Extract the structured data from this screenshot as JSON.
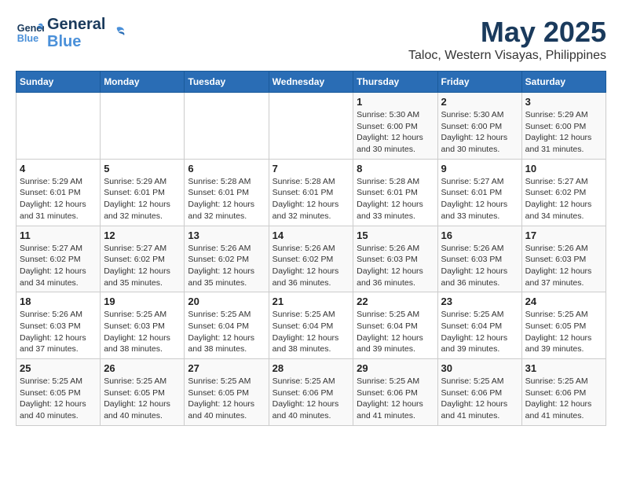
{
  "logo": {
    "line1": "General",
    "line2": "Blue"
  },
  "title": "May 2025",
  "subtitle": "Taloc, Western Visayas, Philippines",
  "weekdays": [
    "Sunday",
    "Monday",
    "Tuesday",
    "Wednesday",
    "Thursday",
    "Friday",
    "Saturday"
  ],
  "weeks": [
    [
      {
        "day": "",
        "info": ""
      },
      {
        "day": "",
        "info": ""
      },
      {
        "day": "",
        "info": ""
      },
      {
        "day": "",
        "info": ""
      },
      {
        "day": "1",
        "info": "Sunrise: 5:30 AM\nSunset: 6:00 PM\nDaylight: 12 hours\nand 30 minutes."
      },
      {
        "day": "2",
        "info": "Sunrise: 5:30 AM\nSunset: 6:00 PM\nDaylight: 12 hours\nand 30 minutes."
      },
      {
        "day": "3",
        "info": "Sunrise: 5:29 AM\nSunset: 6:00 PM\nDaylight: 12 hours\nand 31 minutes."
      }
    ],
    [
      {
        "day": "4",
        "info": "Sunrise: 5:29 AM\nSunset: 6:01 PM\nDaylight: 12 hours\nand 31 minutes."
      },
      {
        "day": "5",
        "info": "Sunrise: 5:29 AM\nSunset: 6:01 PM\nDaylight: 12 hours\nand 32 minutes."
      },
      {
        "day": "6",
        "info": "Sunrise: 5:28 AM\nSunset: 6:01 PM\nDaylight: 12 hours\nand 32 minutes."
      },
      {
        "day": "7",
        "info": "Sunrise: 5:28 AM\nSunset: 6:01 PM\nDaylight: 12 hours\nand 32 minutes."
      },
      {
        "day": "8",
        "info": "Sunrise: 5:28 AM\nSunset: 6:01 PM\nDaylight: 12 hours\nand 33 minutes."
      },
      {
        "day": "9",
        "info": "Sunrise: 5:27 AM\nSunset: 6:01 PM\nDaylight: 12 hours\nand 33 minutes."
      },
      {
        "day": "10",
        "info": "Sunrise: 5:27 AM\nSunset: 6:02 PM\nDaylight: 12 hours\nand 34 minutes."
      }
    ],
    [
      {
        "day": "11",
        "info": "Sunrise: 5:27 AM\nSunset: 6:02 PM\nDaylight: 12 hours\nand 34 minutes."
      },
      {
        "day": "12",
        "info": "Sunrise: 5:27 AM\nSunset: 6:02 PM\nDaylight: 12 hours\nand 35 minutes."
      },
      {
        "day": "13",
        "info": "Sunrise: 5:26 AM\nSunset: 6:02 PM\nDaylight: 12 hours\nand 35 minutes."
      },
      {
        "day": "14",
        "info": "Sunrise: 5:26 AM\nSunset: 6:02 PM\nDaylight: 12 hours\nand 36 minutes."
      },
      {
        "day": "15",
        "info": "Sunrise: 5:26 AM\nSunset: 6:03 PM\nDaylight: 12 hours\nand 36 minutes."
      },
      {
        "day": "16",
        "info": "Sunrise: 5:26 AM\nSunset: 6:03 PM\nDaylight: 12 hours\nand 36 minutes."
      },
      {
        "day": "17",
        "info": "Sunrise: 5:26 AM\nSunset: 6:03 PM\nDaylight: 12 hours\nand 37 minutes."
      }
    ],
    [
      {
        "day": "18",
        "info": "Sunrise: 5:26 AM\nSunset: 6:03 PM\nDaylight: 12 hours\nand 37 minutes."
      },
      {
        "day": "19",
        "info": "Sunrise: 5:25 AM\nSunset: 6:03 PM\nDaylight: 12 hours\nand 38 minutes."
      },
      {
        "day": "20",
        "info": "Sunrise: 5:25 AM\nSunset: 6:04 PM\nDaylight: 12 hours\nand 38 minutes."
      },
      {
        "day": "21",
        "info": "Sunrise: 5:25 AM\nSunset: 6:04 PM\nDaylight: 12 hours\nand 38 minutes."
      },
      {
        "day": "22",
        "info": "Sunrise: 5:25 AM\nSunset: 6:04 PM\nDaylight: 12 hours\nand 39 minutes."
      },
      {
        "day": "23",
        "info": "Sunrise: 5:25 AM\nSunset: 6:04 PM\nDaylight: 12 hours\nand 39 minutes."
      },
      {
        "day": "24",
        "info": "Sunrise: 5:25 AM\nSunset: 6:05 PM\nDaylight: 12 hours\nand 39 minutes."
      }
    ],
    [
      {
        "day": "25",
        "info": "Sunrise: 5:25 AM\nSunset: 6:05 PM\nDaylight: 12 hours\nand 40 minutes."
      },
      {
        "day": "26",
        "info": "Sunrise: 5:25 AM\nSunset: 6:05 PM\nDaylight: 12 hours\nand 40 minutes."
      },
      {
        "day": "27",
        "info": "Sunrise: 5:25 AM\nSunset: 6:05 PM\nDaylight: 12 hours\nand 40 minutes."
      },
      {
        "day": "28",
        "info": "Sunrise: 5:25 AM\nSunset: 6:06 PM\nDaylight: 12 hours\nand 40 minutes."
      },
      {
        "day": "29",
        "info": "Sunrise: 5:25 AM\nSunset: 6:06 PM\nDaylight: 12 hours\nand 41 minutes."
      },
      {
        "day": "30",
        "info": "Sunrise: 5:25 AM\nSunset: 6:06 PM\nDaylight: 12 hours\nand 41 minutes."
      },
      {
        "day": "31",
        "info": "Sunrise: 5:25 AM\nSunset: 6:06 PM\nDaylight: 12 hours\nand 41 minutes."
      }
    ]
  ]
}
